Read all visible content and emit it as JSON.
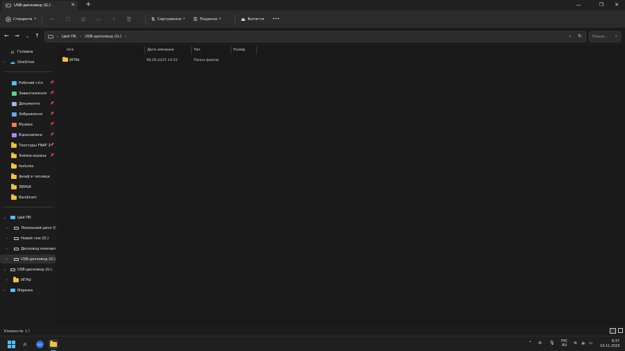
{
  "window": {
    "tab_title": "USB-дисковод (G:)",
    "new_tab": "+",
    "close_tab": "✕",
    "minimize": "—",
    "maximize": "❐",
    "close": "✕"
  },
  "toolbar": {
    "new_label": "Створити",
    "sort_label": "Сортування",
    "view_label": "Подання",
    "eject_label": "Витягти",
    "more": "•••"
  },
  "address": {
    "crumbs": [
      "Цей ПК",
      "USB-дисковод (G:)"
    ],
    "search_placeholder": "Пошук..."
  },
  "sidebar": {
    "home": "Головна",
    "onedrive": "OneDrive",
    "quick": [
      {
        "label": "Робочий стіл",
        "icon": "desktop-icon"
      },
      {
        "label": "Завантаження",
        "icon": "download-icon"
      },
      {
        "label": "Документи",
        "icon": "document-icon"
      },
      {
        "label": "Зображення",
        "icon": "pictures-icon"
      },
      {
        "label": "Музика",
        "icon": "music-icon"
      },
      {
        "label": "Відеозаписи",
        "icon": "video-icon"
      },
      {
        "label": "Текстуры FNAF 2",
        "icon": "folder-icon"
      },
      {
        "label": "Знімки екрана",
        "icon": "folder-icon"
      },
      {
        "label": "textures",
        "icon": "folder-icon"
      },
      {
        "label": "фнаф в теплице",
        "icon": "folder-icon"
      },
      {
        "label": "ЗВУКИ",
        "icon": "folder-icon"
      },
      {
        "label": "Bandicam",
        "icon": "folder-icon"
      }
    ],
    "this_pc": "Цей ПК",
    "drives": [
      {
        "label": "Локальний диск (C:)"
      },
      {
        "label": "Новий том (D:)"
      },
      {
        "label": "Дисковод компакт-"
      },
      {
        "label": "USB-дисковод (G:)"
      }
    ],
    "usb_root": "USB-дисковод (G:)",
    "usb_child": "ИГРЫ",
    "network": "Мережа"
  },
  "columns": {
    "name": "Ім'я",
    "date": "Дата змінення",
    "type": "Тип",
    "size": "Розмір"
  },
  "files": [
    {
      "name": "ИГРЫ",
      "date": "09.09.2025 14:32",
      "type": "Папка файлів",
      "size": ""
    }
  ],
  "status": {
    "items": "Елементів: 1",
    "cursor": "|"
  },
  "tray": {
    "lang1": "РУС",
    "lang2": "RU",
    "time": "9:37",
    "date": "14.11.2025"
  },
  "colors": {
    "accent": "#4cc2ff",
    "folder": "#f0c040"
  }
}
